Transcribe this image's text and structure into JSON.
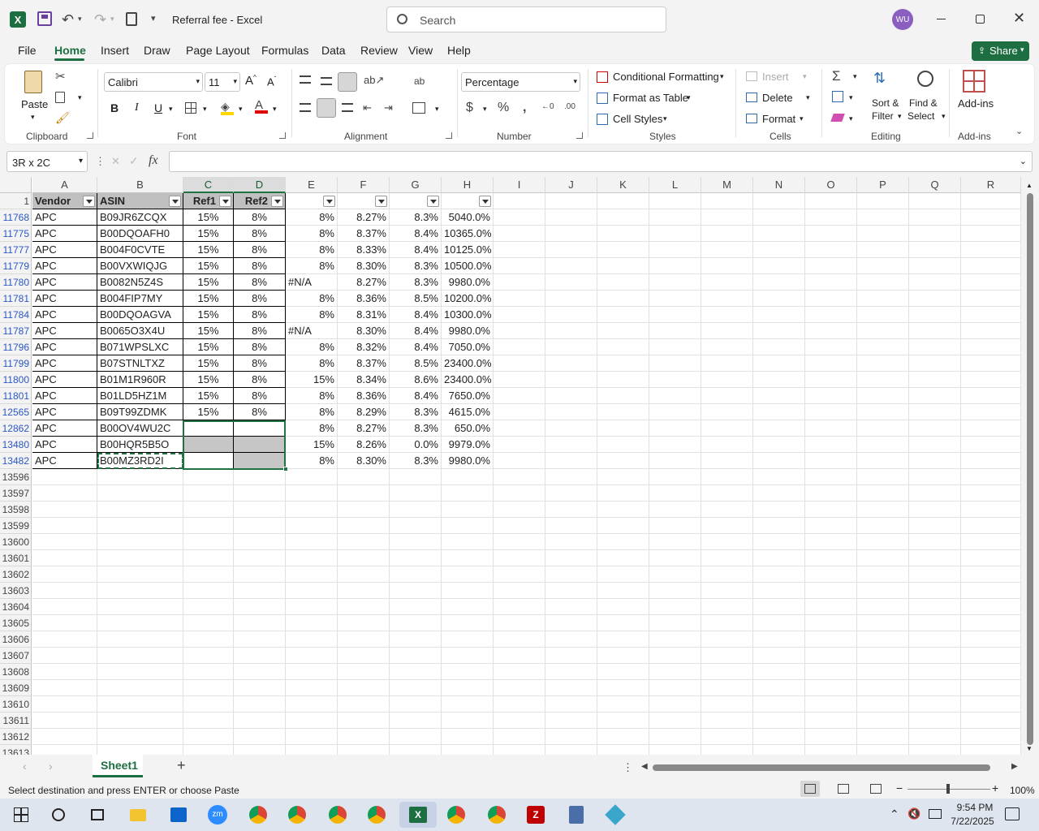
{
  "window": {
    "title": "Referral fee  -  Excel",
    "search_placeholder": "Search",
    "user_initials": "WU"
  },
  "menu": {
    "file": "File",
    "home": "Home",
    "insert": "Insert",
    "draw": "Draw",
    "page_layout": "Page Layout",
    "formulas": "Formulas",
    "data": "Data",
    "review": "Review",
    "view": "View",
    "help": "Help",
    "share": "Share"
  },
  "ribbon": {
    "clipboard": {
      "paste": "Paste",
      "label": "Clipboard"
    },
    "font": {
      "name": "Calibri",
      "size": "11",
      "label": "Font"
    },
    "alignment": {
      "label": "Alignment"
    },
    "number": {
      "format": "Percentage",
      "label": "Number"
    },
    "styles": {
      "conditional": "Conditional Formatting",
      "format_table": "Format as Table",
      "cell_styles": "Cell Styles",
      "label": "Styles"
    },
    "cells": {
      "insert": "Insert",
      "delete": "Delete",
      "format": "Format",
      "label": "Cells"
    },
    "editing": {
      "sort": "Sort &",
      "filter": "Filter",
      "find": "Find &",
      "select": "Select",
      "label": "Editing"
    },
    "addins": {
      "addins": "Add-ins",
      "label": "Add-ins"
    }
  },
  "formula_bar": {
    "name_box": "3R x 2C",
    "fx": "fx",
    "value": ""
  },
  "columns": [
    "A",
    "B",
    "C",
    "D",
    "E",
    "F",
    "G",
    "H",
    "I",
    "J",
    "K",
    "L",
    "M",
    "N",
    "O",
    "P",
    "Q",
    "R"
  ],
  "header_row": {
    "num": "1",
    "a": "Vendor",
    "b": "ASIN",
    "c": "Ref1",
    "d": "Ref2"
  },
  "rows": [
    {
      "num": "11768",
      "a": "APC",
      "b": "B09JR6ZCQX",
      "c": "15%",
      "d": "8%",
      "e": "8%",
      "f": "8.27%",
      "g": "8.3%",
      "h": "5040.0%"
    },
    {
      "num": "11775",
      "a": "APC",
      "b": "B00DQOAFH0",
      "c": "15%",
      "d": "8%",
      "e": "8%",
      "f": "8.37%",
      "g": "8.4%",
      "h": "10365.0%"
    },
    {
      "num": "11777",
      "a": "APC",
      "b": "B004F0CVTE",
      "c": "15%",
      "d": "8%",
      "e": "8%",
      "f": "8.33%",
      "g": "8.4%",
      "h": "10125.0%"
    },
    {
      "num": "11779",
      "a": "APC",
      "b": "B00VXWIQJG",
      "c": "15%",
      "d": "8%",
      "e": "8%",
      "f": "8.30%",
      "g": "8.3%",
      "h": "10500.0%"
    },
    {
      "num": "11780",
      "a": "APC",
      "b": "B0082N5Z4S",
      "c": "15%",
      "d": "8%",
      "e": "#N/A",
      "f": "8.27%",
      "g": "8.3%",
      "h": "9980.0%"
    },
    {
      "num": "11781",
      "a": "APC",
      "b": "B004FIP7MY",
      "c": "15%",
      "d": "8%",
      "e": "8%",
      "f": "8.36%",
      "g": "8.5%",
      "h": "10200.0%"
    },
    {
      "num": "11784",
      "a": "APC",
      "b": "B00DQOAGVA",
      "c": "15%",
      "d": "8%",
      "e": "8%",
      "f": "8.31%",
      "g": "8.4%",
      "h": "10300.0%"
    },
    {
      "num": "11787",
      "a": "APC",
      "b": "B0065O3X4U",
      "c": "15%",
      "d": "8%",
      "e": "#N/A",
      "f": "8.30%",
      "g": "8.4%",
      "h": "9980.0%"
    },
    {
      "num": "11796",
      "a": "APC",
      "b": "B071WPSLXC",
      "c": "15%",
      "d": "8%",
      "e": "8%",
      "f": "8.32%",
      "g": "8.4%",
      "h": "7050.0%"
    },
    {
      "num": "11799",
      "a": "APC",
      "b": "B07STNLTXZ",
      "c": "15%",
      "d": "8%",
      "e": "8%",
      "f": "8.37%",
      "g": "8.5%",
      "h": "23400.0%"
    },
    {
      "num": "11800",
      "a": "APC",
      "b": "B01M1R960R",
      "c": "15%",
      "d": "8%",
      "e": "15%",
      "f": "8.34%",
      "g": "8.6%",
      "h": "23400.0%"
    },
    {
      "num": "11801",
      "a": "APC",
      "b": "B01LD5HZ1M",
      "c": "15%",
      "d": "8%",
      "e": "8%",
      "f": "8.36%",
      "g": "8.4%",
      "h": "7650.0%"
    },
    {
      "num": "12565",
      "a": "APC",
      "b": "B09T99ZDMK",
      "c": "15%",
      "d": "8%",
      "e": "8%",
      "f": "8.29%",
      "g": "8.3%",
      "h": "4615.0%"
    },
    {
      "num": "12862",
      "a": "APC",
      "b": "B00OV4WU2C",
      "c": "",
      "d": "",
      "e": "8%",
      "f": "8.27%",
      "g": "8.3%",
      "h": "650.0%"
    },
    {
      "num": "13480",
      "a": "APC",
      "b": "B00HQR5B5O",
      "c": "",
      "d": "",
      "e": "15%",
      "f": "8.26%",
      "g": "0.0%",
      "h": "9979.0%"
    },
    {
      "num": "13482",
      "a": "APC",
      "b": "B00MZ3RD2I",
      "c": "",
      "d": "",
      "e": "8%",
      "f": "8.30%",
      "g": "8.3%",
      "h": "9980.0%"
    }
  ],
  "empty_rows": [
    "13596",
    "13597",
    "13598",
    "13599",
    "13600",
    "13601",
    "13602",
    "13603",
    "13604",
    "13605",
    "13606",
    "13607",
    "13608",
    "13609",
    "13610",
    "13611",
    "13612",
    "13613"
  ],
  "sheet": {
    "tab": "Sheet1",
    "add": "+"
  },
  "status": {
    "message": "Select destination and press ENTER or choose Paste",
    "zoom": "100%"
  },
  "taskbar": {
    "time": "9:54 PM",
    "date": "7/22/2025"
  }
}
